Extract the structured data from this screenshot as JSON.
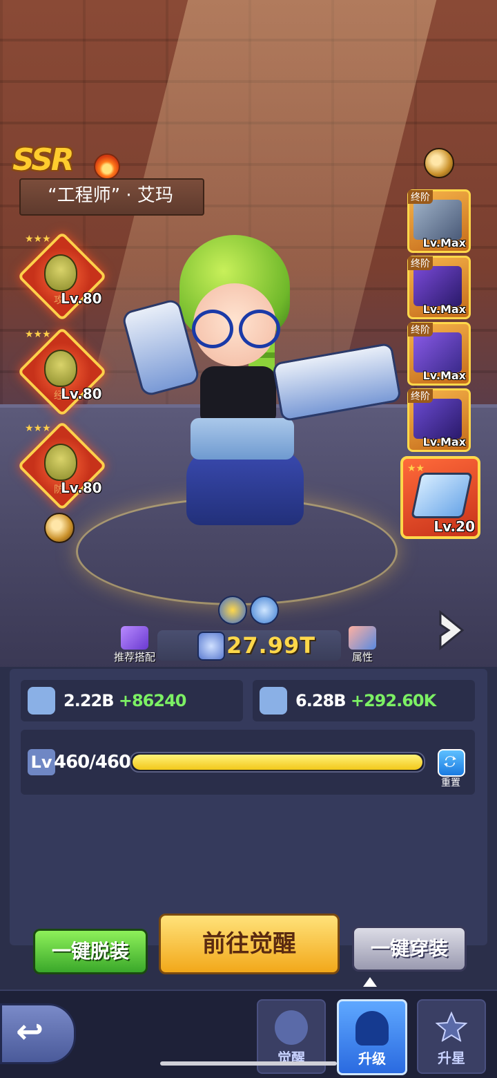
{
  "hero": {
    "rarity": "SSR",
    "name": "“工程师” · 艾玛",
    "element_icon": "fire-icon"
  },
  "skills": [
    {
      "icon": "durian-boxer-icon",
      "tag": "攻",
      "level": "Lv.80",
      "stars": 3
    },
    {
      "icon": "durian-angry-icon",
      "tag": "经",
      "level": "Lv.80",
      "stars": 3
    },
    {
      "icon": "durian-detective-icon",
      "tag": "防",
      "level": "Lv.80",
      "stars": 3
    }
  ],
  "equipment": [
    {
      "tier": "终阶",
      "level": "Lv.Max",
      "icon": "axe-icon"
    },
    {
      "tier": "终阶",
      "level": "Lv.Max",
      "icon": "armor-icon"
    },
    {
      "tier": "终阶",
      "level": "Lv.Max",
      "icon": "helmet-icon"
    },
    {
      "tier": "终阶",
      "level": "Lv.Max",
      "icon": "boots-icon"
    }
  ],
  "weapon": {
    "level": "Lv.20",
    "icon": "wrench-weapon-icon",
    "stars": 2
  },
  "power": {
    "value": "27.99T",
    "icon": "fist-icon"
  },
  "side_buttons": {
    "recommend_label": "推荐搭配",
    "attributes_label": "属性"
  },
  "stats": {
    "attack": {
      "value": "2.22B",
      "increase": "+86240",
      "icon": "attack-crown-icon"
    },
    "hp": {
      "value": "6.28B",
      "increase": "+292.60K",
      "icon": "heart-icon"
    }
  },
  "level": {
    "tag": "Lv",
    "text": "460/460",
    "progress": 1.0,
    "reset_label": "重置"
  },
  "actions": {
    "unequip_all": "一键脱装",
    "go_awaken": "前往觉醒",
    "equip_all": "一键穿装"
  },
  "tabs": [
    {
      "label": "觉醒",
      "icon": "flame-icon",
      "active": false
    },
    {
      "label": "升级",
      "icon": "hero-silhouette-icon",
      "active": true
    },
    {
      "label": "升星",
      "icon": "star-icon",
      "active": false
    }
  ],
  "colors": {
    "power_text": "#ffd84a",
    "stat_increase": "#7cf064",
    "active_tab": "#2a6ae0"
  }
}
